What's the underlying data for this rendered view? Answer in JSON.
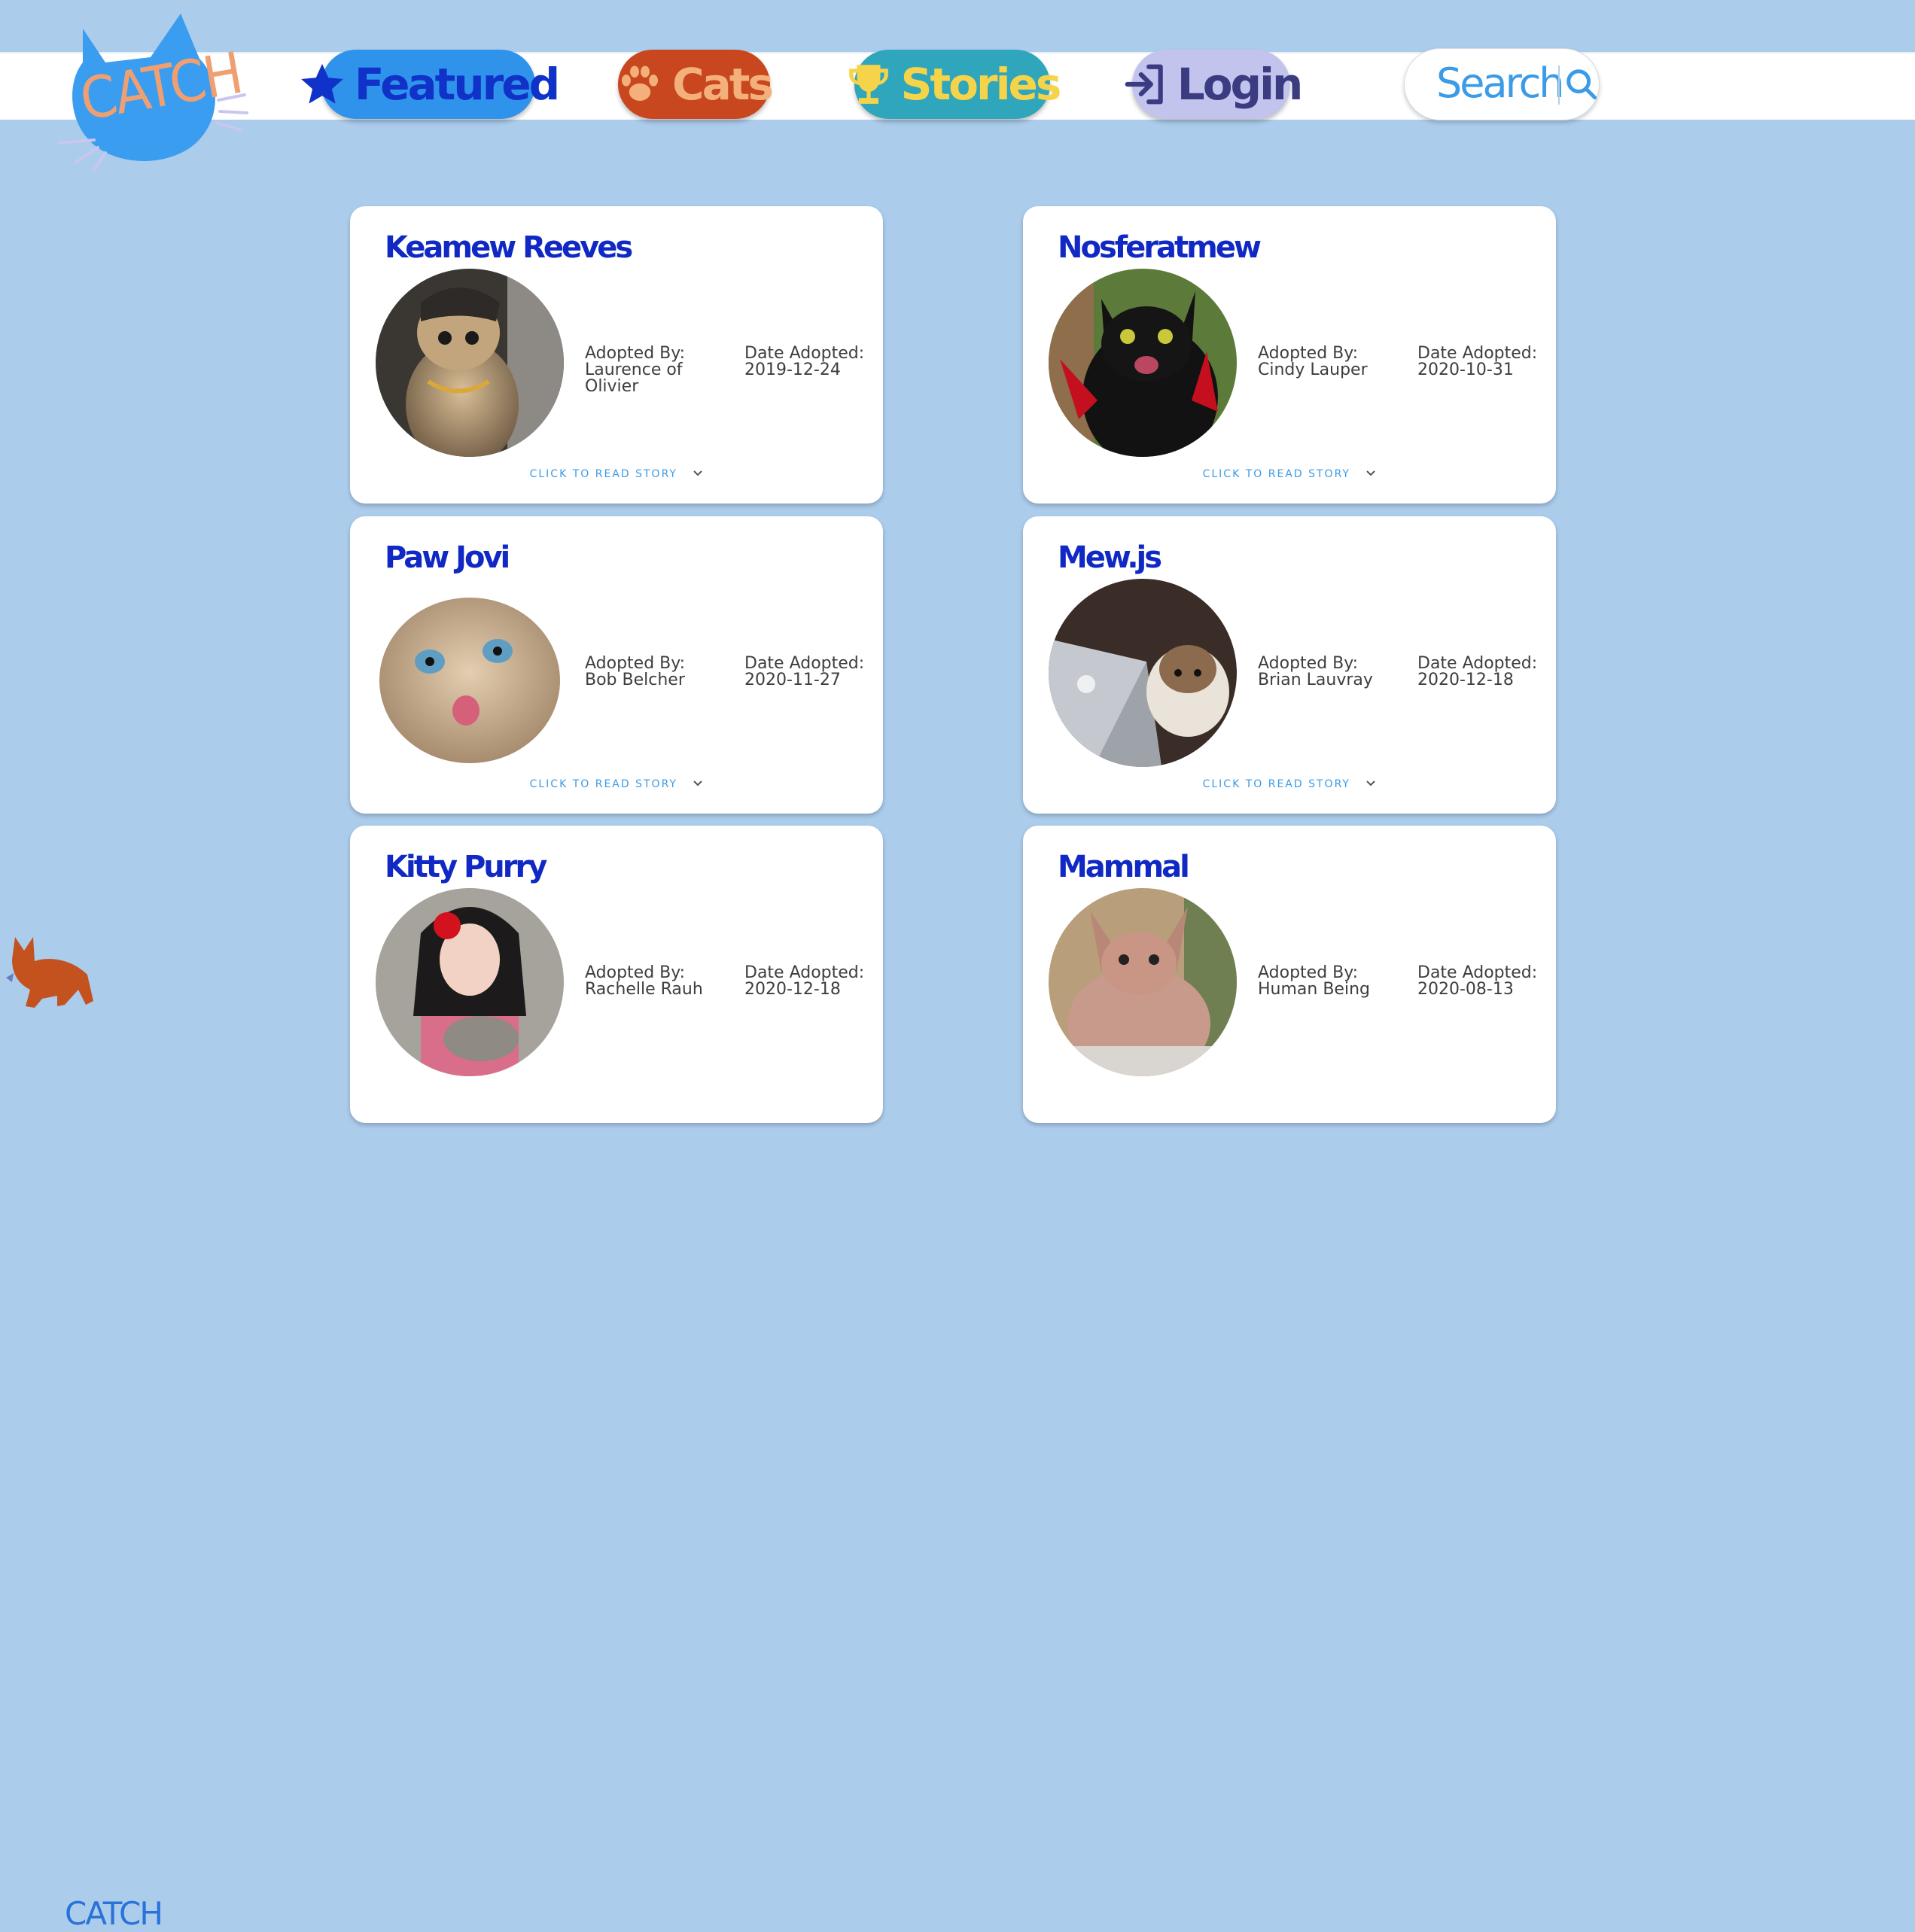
{
  "brand": {
    "name": "CATCH"
  },
  "nav": {
    "featured": "Featured",
    "cats": "Cats",
    "stories": "Stories",
    "login": "Login"
  },
  "search": {
    "label": "Search"
  },
  "labels": {
    "adopted_by": "Adopted By:",
    "date_adopted": "Date Adopted:",
    "read_story": "CLICK TO READ STORY"
  },
  "cards": [
    {
      "name": "Keamew Reeves",
      "adopted_by": "Laurence of Olivier",
      "date": "2019-12-24",
      "photo_icon": "tabby-cat-with-chain-photo"
    },
    {
      "name": "Nosferatmew",
      "adopted_by": "Cindy Lauper",
      "date": "2020-10-31",
      "photo_icon": "black-cat-vampire-cape-photo"
    },
    {
      "name": "Paw Jovi",
      "adopted_by": "Bob Belcher",
      "date": "2020-11-27",
      "photo_icon": "cat-licking-lips-photo"
    },
    {
      "name": "Mew.js",
      "adopted_by": "Brian Lauvray",
      "date": "2020-12-18",
      "photo_icon": "cat-at-laptop-photo"
    },
    {
      "name": "Kitty Purry",
      "adopted_by": "Rachelle Rauh",
      "date": "2020-12-18",
      "photo_icon": "woman-holding-cat-photo"
    },
    {
      "name": "Mammal",
      "adopted_by": "Human Being",
      "date": "2020-08-13",
      "photo_icon": "sphynx-cat-photo"
    }
  ],
  "colors": {
    "background": "#acccec",
    "featured": "#2f93ec",
    "cats": "#c8471e",
    "stories": "#2fa6bc",
    "login": "#c2c4ee",
    "card_title": "#1029c4"
  }
}
